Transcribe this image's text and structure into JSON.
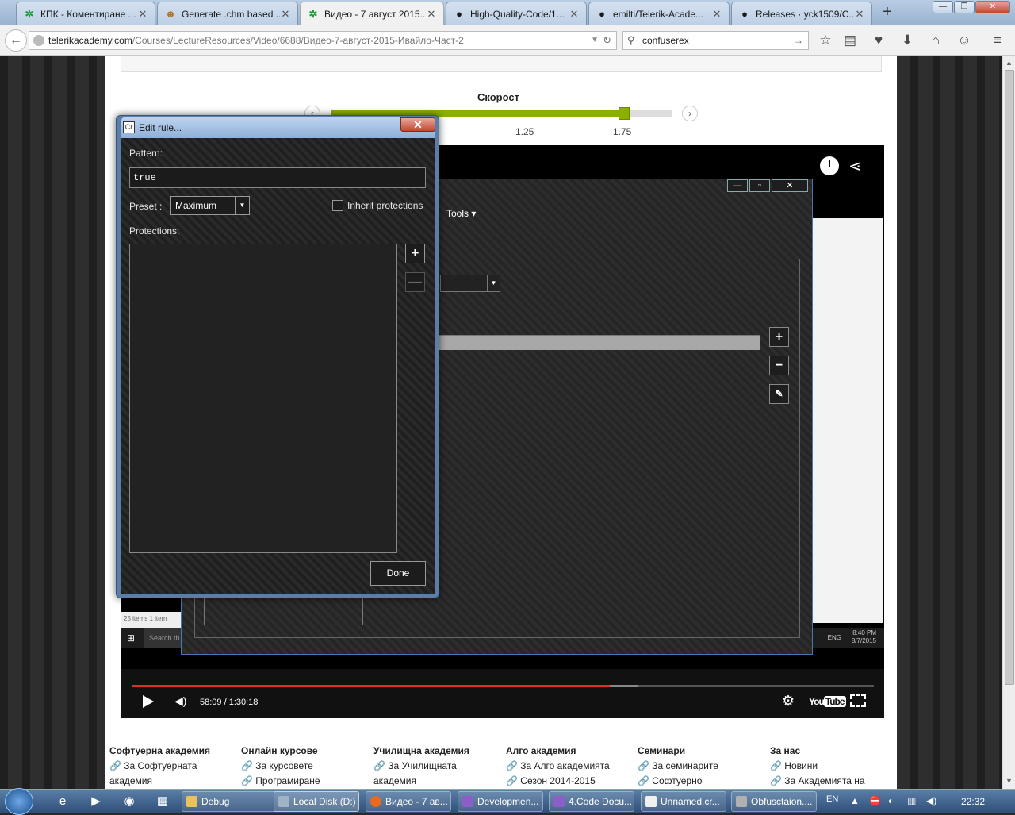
{
  "browser": {
    "tabs": [
      {
        "title": "КПК - Коментиране ...",
        "icon": "green-telerik-icon"
      },
      {
        "title": "Generate .chm based ...",
        "icon": "owl-icon"
      },
      {
        "title": "Видео - 7 август 2015...",
        "icon": "green-telerik-icon",
        "active": true
      },
      {
        "title": "High-Quality-Code/1...",
        "icon": "github-icon"
      },
      {
        "title": "emilti/Telerik-Acade...",
        "icon": "github-icon"
      },
      {
        "title": "Releases · yck1509/C...",
        "icon": "github-icon"
      }
    ],
    "new_tab": "+",
    "url_host": "telerikacademy.com",
    "url_path": "/Courses/LectureResources/Video/6688/Видео-7-август-2015-Ивайло-Част-2",
    "search_value": "confuserex"
  },
  "page": {
    "speed": {
      "label": "Скорост",
      "ticks": [
        "1.25",
        "1.75"
      ],
      "value": 1.75,
      "fill_fraction": 0.86
    },
    "video": {
      "time": "58:09 / 1:30:18",
      "played_fraction": 0.644,
      "loaded_fraction": 0.682,
      "youtube": "You",
      "youtube2": "Tube",
      "inner_app": {
        "tools_label": "Tools ▾",
        "ss_items": "25 items   1 item",
        "ss_search": "Search th",
        "ss_eng": "ENG",
        "ss_time": "8:40 PM",
        "ss_date": "8/7/2015"
      }
    },
    "footer": [
      {
        "heading": "Софтуерна академия",
        "items": [
          "За Софтуерната",
          "академия"
        ]
      },
      {
        "heading": "Онлайн курсове",
        "items": [
          "За курсовете",
          "Програмиране"
        ]
      },
      {
        "heading": "Училищна академия",
        "items": [
          "За Училищната",
          "академия"
        ]
      },
      {
        "heading": "Алго академия",
        "items": [
          "За Алго академията",
          "Сезон 2014-2015"
        ]
      },
      {
        "heading": "Семинари",
        "items": [
          "За семинарите",
          "Софтуерно"
        ]
      },
      {
        "heading": "За нас",
        "items": [
          "Новини",
          "За Академията на"
        ]
      }
    ]
  },
  "dialog": {
    "title": "Edit rule...",
    "close": "✕",
    "pattern_label": "Pattern:",
    "pattern_value": "true",
    "preset_label": "Preset :",
    "preset_value": "Maximum",
    "inherit_label": "Inherit protections",
    "inherit_checked": false,
    "protections_label": "Protections:",
    "add": "+",
    "remove": "—",
    "done": "Done"
  },
  "taskbar": {
    "buttons": [
      {
        "label": "Debug",
        "color": "#e8c35a"
      },
      {
        "label": "Local Disk (D:)",
        "color": "#9fb2c6"
      },
      {
        "label": "Видео - 7 ав...",
        "color": "#e86a1e"
      },
      {
        "label": "Developmen...",
        "color": "#8c5ec7"
      },
      {
        "label": "4.Code Docu...",
        "color": "#8c5ec7"
      },
      {
        "label": "Unnamed.cr...",
        "color": "#f0f0f0"
      },
      {
        "label": "Obfusctaion....",
        "color": "#b0b0b0"
      }
    ],
    "lang": "EN",
    "time": "22:32"
  }
}
